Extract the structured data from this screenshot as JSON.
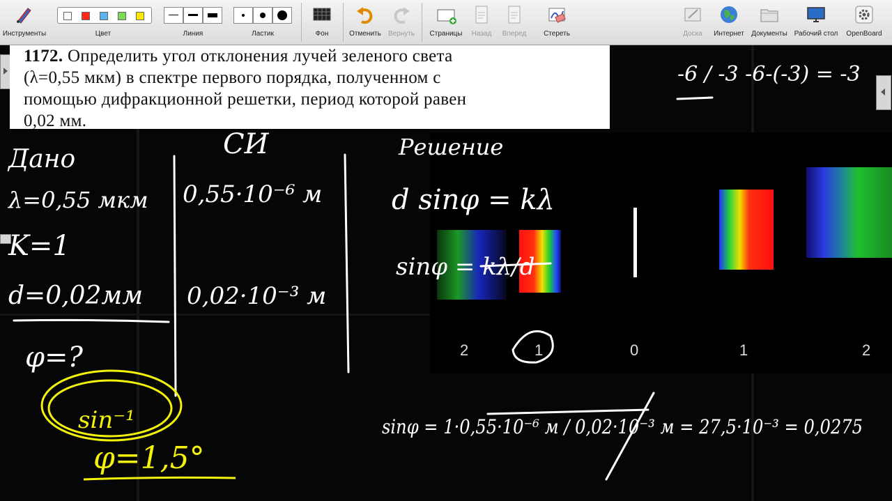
{
  "toolbar": {
    "left_items": [
      {
        "label": "Инструменты",
        "icon": "tools-icon"
      },
      {
        "label": "Цвет",
        "icon": "color-palette-icon"
      },
      {
        "label": "Линия",
        "icon": "line-width-icon"
      },
      {
        "label": "Ластик",
        "icon": "eraser-size-icon"
      },
      {
        "label": "Фон",
        "icon": "background-icon"
      },
      {
        "label": "Отменить",
        "icon": "undo-icon"
      },
      {
        "label": "Вернуть",
        "icon": "redo-icon"
      },
      {
        "label": "Страницы",
        "icon": "pages-icon"
      },
      {
        "label": "Назад",
        "icon": "previous-page-icon"
      },
      {
        "label": "Вперед",
        "icon": "next-page-icon"
      },
      {
        "label": "Стереть",
        "icon": "clear-page-icon"
      }
    ],
    "right_items": [
      {
        "label": "Доска",
        "icon": "board-icon"
      },
      {
        "label": "Интернет",
        "icon": "globe-icon"
      },
      {
        "label": "Документы",
        "icon": "folder-icon"
      },
      {
        "label": "Рабочий стол",
        "icon": "desktop-icon"
      },
      {
        "label": "OpenBoard",
        "icon": "gear-icon"
      }
    ],
    "colors": [
      "#ffffff",
      "#ff2a1a",
      "#5ab4f0",
      "#7ed957",
      "#ffe800"
    ]
  },
  "problem": {
    "number": "1172.",
    "lines": [
      "Определить угол отклонения лучей зеленого света",
      "(λ=0,55 мкм) в спектре первого порядка, полученном с",
      "помощью дифракционной решетки, период которой равен",
      "0,02 мм."
    ]
  },
  "spectrum": {
    "orders": [
      "2",
      "1",
      "0",
      "1",
      "2"
    ]
  },
  "handwriting": {
    "given_title": "Дано",
    "si_title": "СИ",
    "solution_title": "Решение",
    "given": [
      "λ=0,55 мкм",
      "K=1",
      "d=0,02мм",
      "φ=?"
    ],
    "si": [
      "0,55·10⁻⁶ м",
      "0,02·10⁻³ м"
    ],
    "formula1": "d sinφ = kλ",
    "formula2": "sinφ = kλ/d",
    "calc": "sinφ = 1·0,55·10⁻⁶ м / 0,02·10⁻³ м = 27,5·10⁻³ = 0,0275",
    "side_note": "-6 / -3   -6-(-3) = -3",
    "arcsin": "sin⁻¹",
    "answer": "φ=1,5°"
  },
  "colors": {
    "ink": "#ffffff",
    "highlight": "#f2f20a",
    "toolbar_bg": "#e6e6e6"
  }
}
